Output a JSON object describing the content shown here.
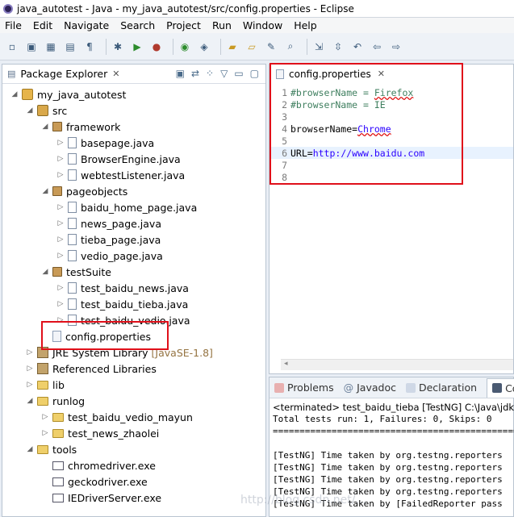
{
  "window": {
    "title": "java_autotest - Java - my_java_autotest/src/config.properties - Eclipse"
  },
  "menu": [
    "File",
    "Edit",
    "Navigate",
    "Search",
    "Project",
    "Run",
    "Window",
    "Help"
  ],
  "package_explorer": {
    "title": "Package Explorer",
    "tree": [
      {
        "label": "my_java_autotest",
        "arrow": "◢",
        "icon": "project",
        "indent": 0
      },
      {
        "label": "src",
        "arrow": "◢",
        "icon": "src",
        "indent": 1
      },
      {
        "label": "framework",
        "arrow": "◢",
        "icon": "pkg",
        "indent": 2
      },
      {
        "label": "basepage.java",
        "arrow": "▷",
        "icon": "java",
        "indent": 3
      },
      {
        "label": "BrowserEngine.java",
        "arrow": "▷",
        "icon": "java",
        "indent": 3
      },
      {
        "label": "webtestListener.java",
        "arrow": "▷",
        "icon": "java",
        "indent": 3
      },
      {
        "label": "pageobjects",
        "arrow": "◢",
        "icon": "pkg",
        "indent": 2
      },
      {
        "label": "baidu_home_page.java",
        "arrow": "▷",
        "icon": "java",
        "indent": 3
      },
      {
        "label": "news_page.java",
        "arrow": "▷",
        "icon": "java",
        "indent": 3
      },
      {
        "label": "tieba_page.java",
        "arrow": "▷",
        "icon": "java",
        "indent": 3
      },
      {
        "label": "vedio_page.java",
        "arrow": "▷",
        "icon": "java",
        "indent": 3
      },
      {
        "label": "testSuite",
        "arrow": "◢",
        "icon": "pkg",
        "indent": 2
      },
      {
        "label": "test_baidu_news.java",
        "arrow": "▷",
        "icon": "java",
        "indent": 3
      },
      {
        "label": "test_baidu_tieba.java",
        "arrow": "▷",
        "icon": "java",
        "indent": 3
      },
      {
        "label": "test_baidu_vedio.java",
        "arrow": "▷",
        "icon": "java",
        "indent": 3
      },
      {
        "label": "config.properties",
        "arrow": "",
        "icon": "file",
        "indent": 2
      },
      {
        "label": "JRE System Library",
        "tag": "[JavaSE-1.8]",
        "arrow": "▷",
        "icon": "lib",
        "indent": 1
      },
      {
        "label": "Referenced Libraries",
        "arrow": "▷",
        "icon": "lib",
        "indent": 1
      },
      {
        "label": "lib",
        "arrow": "▷",
        "icon": "folder",
        "indent": 1
      },
      {
        "label": "runlog",
        "arrow": "◢",
        "icon": "folder",
        "indent": 1
      },
      {
        "label": "test_baidu_vedio_mayun",
        "arrow": "▷",
        "icon": "folder",
        "indent": 2
      },
      {
        "label": "test_news_zhaolei",
        "arrow": "▷",
        "icon": "folder",
        "indent": 2
      },
      {
        "label": "tools",
        "arrow": "◢",
        "icon": "folder",
        "indent": 1
      },
      {
        "label": "chromedriver.exe",
        "arrow": "",
        "icon": "exe",
        "indent": 2
      },
      {
        "label": "geckodriver.exe",
        "arrow": "",
        "icon": "exe",
        "indent": 2
      },
      {
        "label": "IEDriverServer.exe",
        "arrow": "",
        "icon": "exe",
        "indent": 2
      }
    ]
  },
  "editor": {
    "tab": "config.properties",
    "lines": [
      {
        "n": "1",
        "comment": "#browserName = ",
        "value": "Firefox"
      },
      {
        "n": "2",
        "comment": "#browserName = IE",
        "value": ""
      },
      {
        "n": "3"
      },
      {
        "n": "4",
        "key": "browserName=",
        "value": "Chrome"
      },
      {
        "n": "5"
      },
      {
        "n": "6",
        "key": "URL=",
        "value": "http://www.baidu.com"
      },
      {
        "n": "7"
      },
      {
        "n": "8"
      }
    ]
  },
  "console": {
    "tabs": [
      "Problems",
      "Javadoc",
      "Declaration",
      "Con"
    ],
    "terminated": "<terminated> test_baidu_tieba [TestNG] C:\\Java\\jdk",
    "lines": [
      "Total tests run: 1, Failures: 0, Skips: 0",
      "================================================",
      "",
      "[TestNG] Time taken by org.testng.reporters",
      "[TestNG] Time taken by org.testng.reporters",
      "[TestNG] Time taken by org.testng.reporters",
      "[TestNG] Time taken by org.testng.reporters",
      "[TestNG] Time taken by [FailedReporter pass"
    ]
  },
  "watermark": "http://blog.csdn.net/..."
}
